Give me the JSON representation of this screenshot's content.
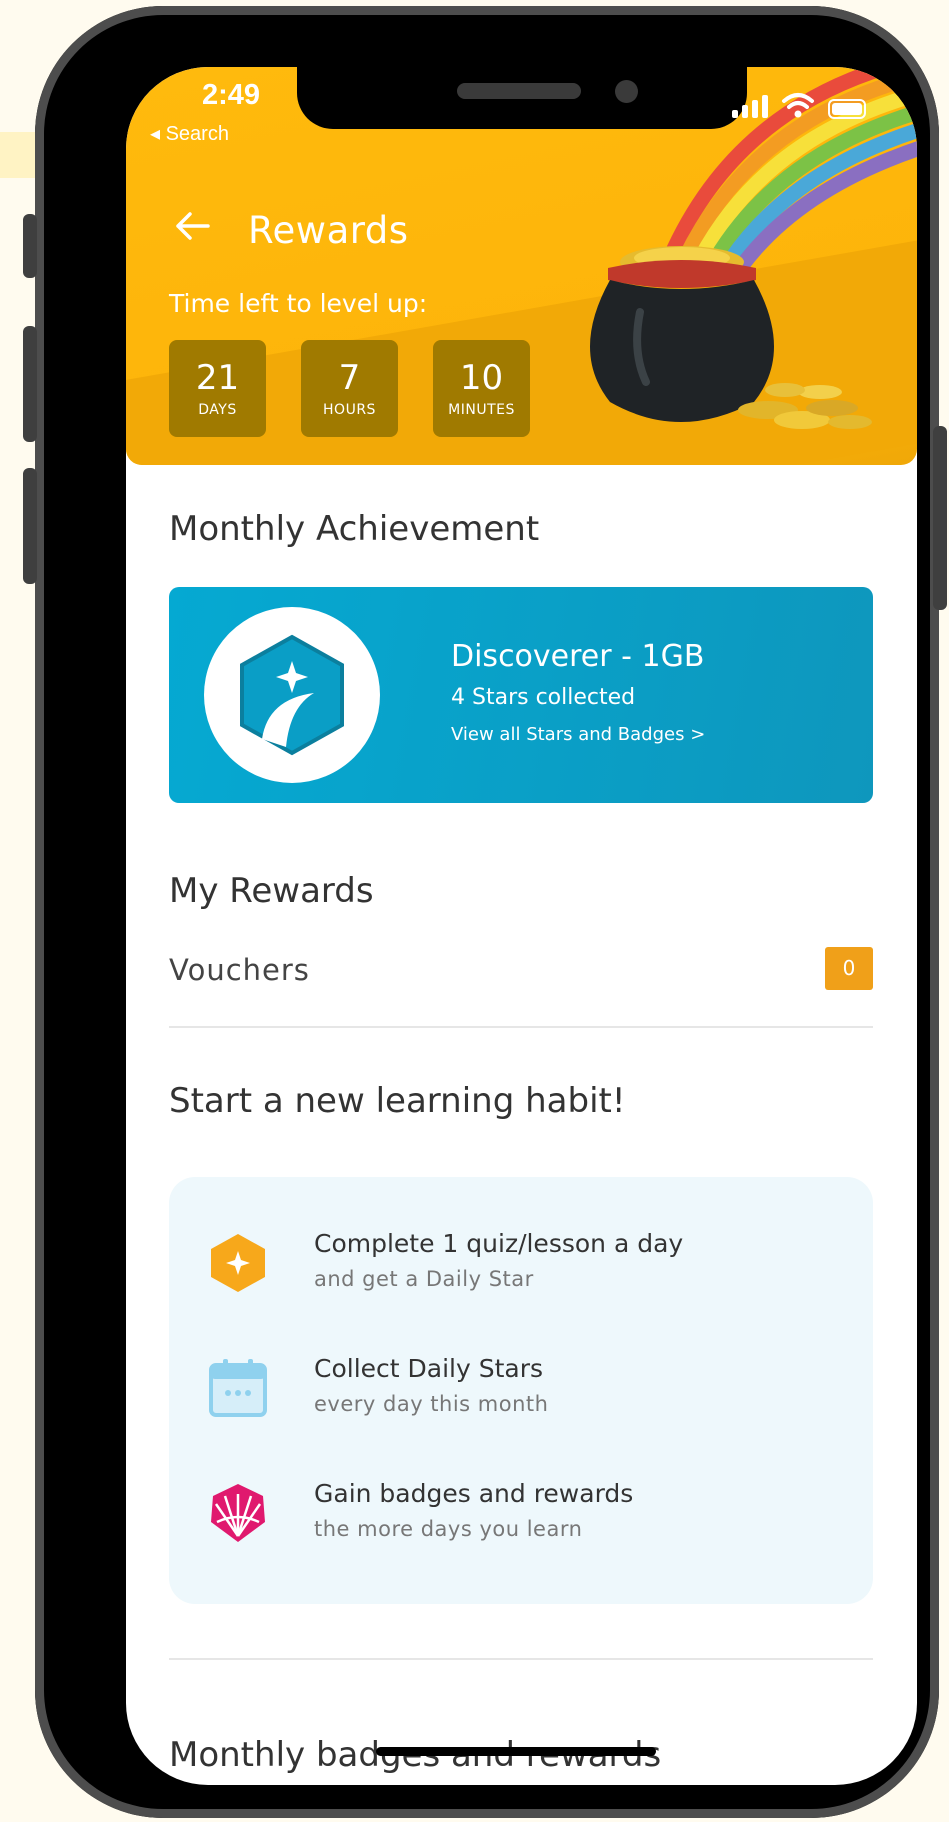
{
  "status_bar": {
    "time": "2:49",
    "back_app": "◂ Search"
  },
  "header": {
    "title": "Rewards",
    "level_label": "Time left to level up:",
    "timers": [
      {
        "value": "21",
        "unit": "DAYS"
      },
      {
        "value": "7",
        "unit": "HOURS"
      },
      {
        "value": "10",
        "unit": "MINUTES"
      }
    ]
  },
  "monthly_achievement": {
    "heading": "Monthly Achievement",
    "name": "Discoverer - 1GB",
    "stars": "4 Stars collected",
    "link": "View all Stars and Badges >"
  },
  "my_rewards": {
    "heading": "My Rewards",
    "vouchers_label": "Vouchers",
    "vouchers_count": "0"
  },
  "habit": {
    "heading": "Start a new learning habit!",
    "items": [
      {
        "icon": "star-hexagon-icon",
        "title": "Complete 1 quiz/lesson a day",
        "sub": "and get a Daily Star"
      },
      {
        "icon": "calendar-icon",
        "title": "Collect Daily Stars",
        "sub": "every day this month"
      },
      {
        "icon": "badge-shell-icon",
        "title": "Gain badges and rewards",
        "sub": "the more days you learn"
      }
    ]
  },
  "monthly_badges": {
    "heading": "Monthly badges and rewards"
  },
  "colors": {
    "header": "#ffba0d",
    "timer_box": "#a07a00",
    "achievement_card": "#05a9d2",
    "voucher_badge": "#f0a019",
    "habit_card": "#eef8fc"
  }
}
